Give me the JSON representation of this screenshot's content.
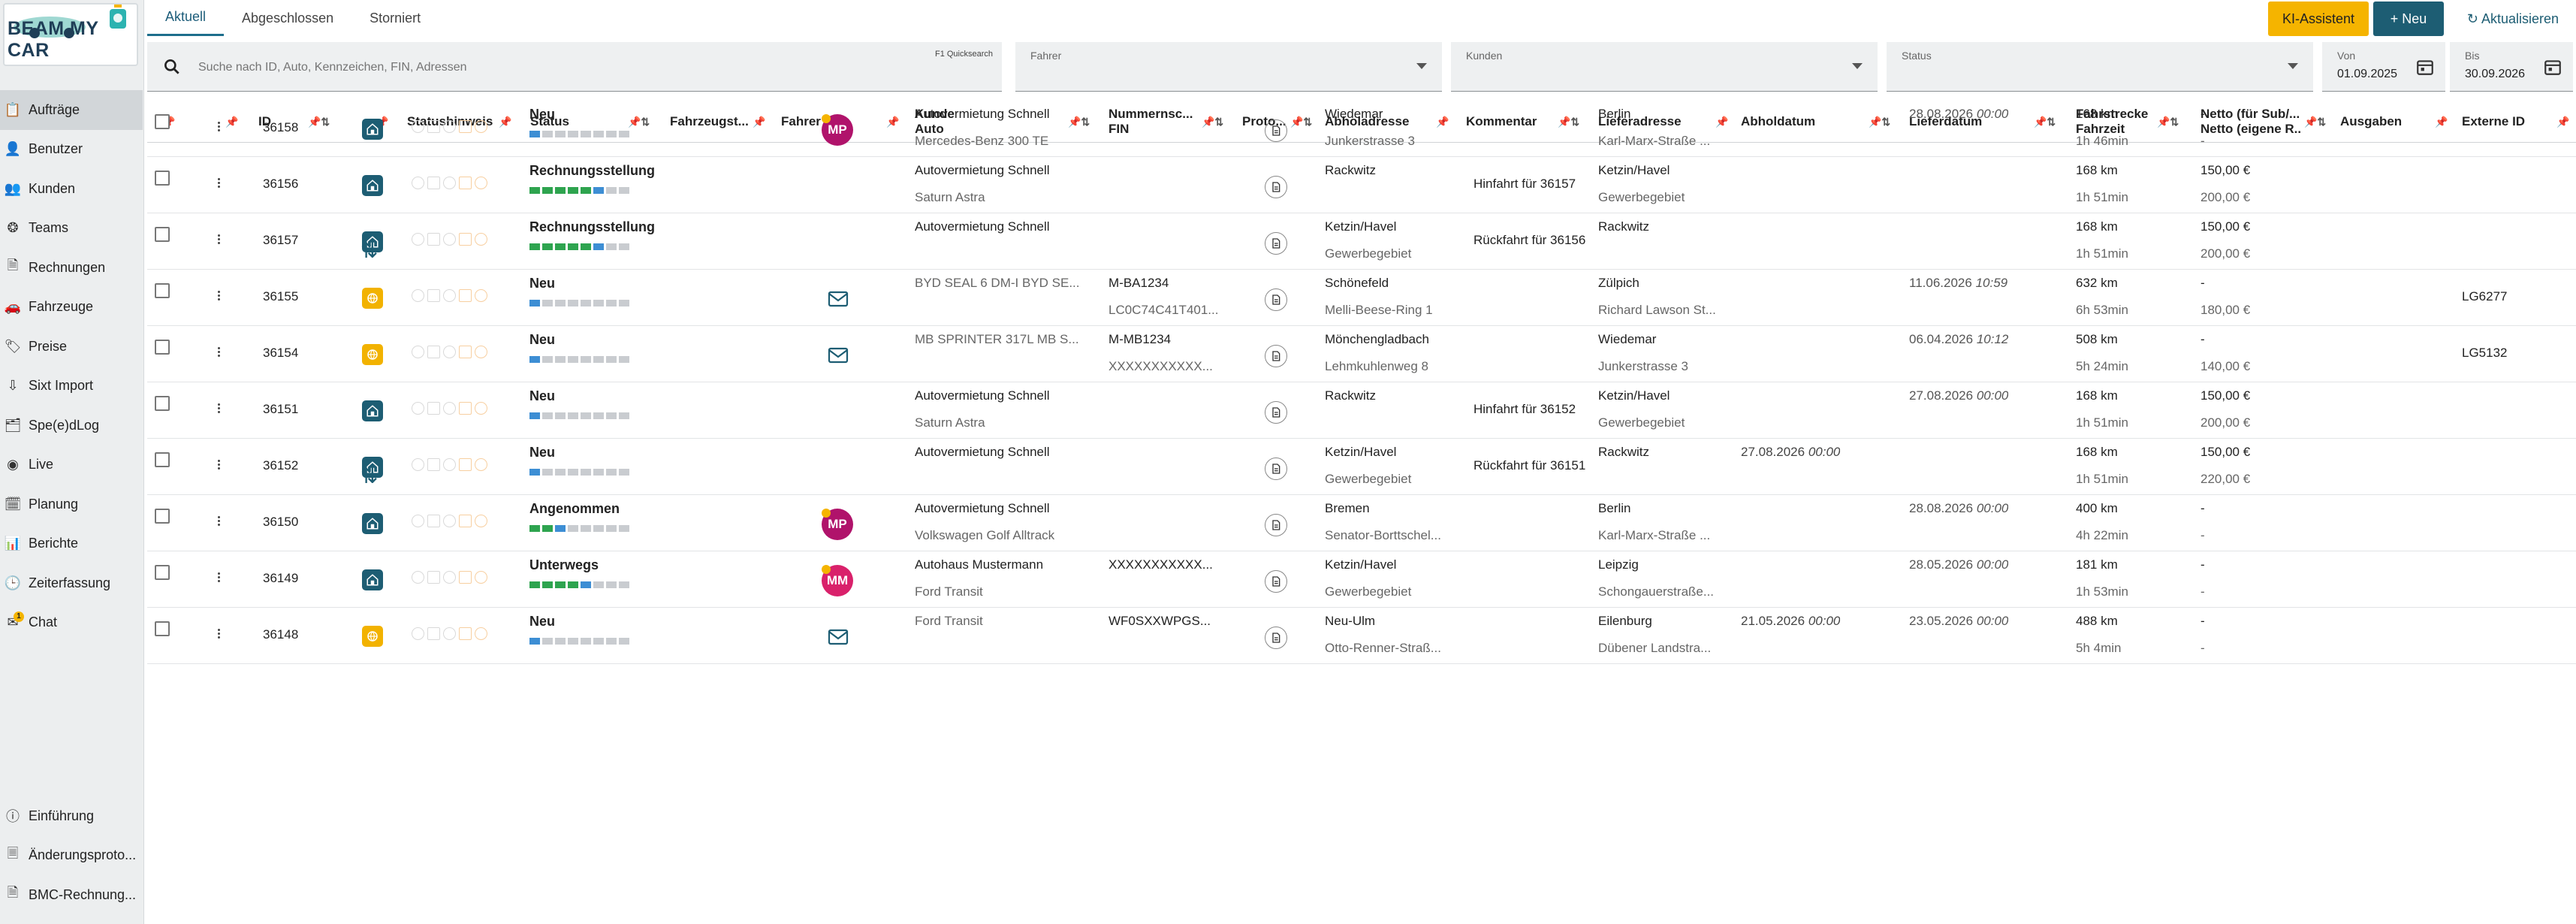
{
  "app": {
    "logo_text": "BEAM MY CAR"
  },
  "sidebar": {
    "items": [
      {
        "label": "Aufträge",
        "icon": "clipboard-icon",
        "active": true
      },
      {
        "label": "Benutzer",
        "icon": "user-icon"
      },
      {
        "label": "Kunden",
        "icon": "users-icon"
      },
      {
        "label": "Teams",
        "icon": "team-icon"
      },
      {
        "label": "Rechnungen",
        "icon": "invoice-icon"
      },
      {
        "label": "Fahrzeuge",
        "icon": "car-icon"
      },
      {
        "label": "Preise",
        "icon": "price-icon"
      },
      {
        "label": "Sixt Import",
        "icon": "import-icon"
      },
      {
        "label": "Spe(e)dLog",
        "icon": "log-icon"
      },
      {
        "label": "Live",
        "icon": "live-icon"
      },
      {
        "label": "Planung",
        "icon": "calendar-icon"
      },
      {
        "label": "Berichte",
        "icon": "chart-icon"
      },
      {
        "label": "Zeiterfassung",
        "icon": "clock-icon"
      },
      {
        "label": "Chat",
        "icon": "mail-icon",
        "badge": "1"
      }
    ],
    "bottom": [
      {
        "label": "Einführung",
        "icon": "info-icon"
      },
      {
        "label": "Änderungsproto...",
        "icon": "history-icon"
      },
      {
        "label": "BMC-Rechnung...",
        "icon": "invoice-icon"
      }
    ]
  },
  "tabs": [
    "Aktuell",
    "Abgeschlossen",
    "Storniert"
  ],
  "toolbar": {
    "ki": "KI-Assistent",
    "neu": "+ Neu",
    "refresh": "Aktualisieren"
  },
  "filters": {
    "search_placeholder": "Suche nach ID, Auto, Kennzeichen, FIN, Adressen",
    "quicksearch": "F1 Quicksearch",
    "fahrer": "Fahrer",
    "kunden": "Kunden",
    "status": "Status",
    "von_label": "Von",
    "von_value": "01.09.2025",
    "bis_label": "Bis",
    "bis_value": "30.09.2026"
  },
  "columns": {
    "id": "ID",
    "statushinweis": "Statushinweis",
    "status": "Status",
    "fahrzeug": "Fahrzeugst...",
    "fahrer": "Fahrer",
    "kunde": "Kunde",
    "auto": "Auto",
    "nummer": "Nummernsc...",
    "fin": "FIN",
    "proto": "Proto...",
    "abholadresse": "Abholadresse",
    "kommentar": "Kommentar",
    "lieferadresse": "Lieferadresse",
    "abholdatum": "Abholdatum",
    "lieferdatum": "Lieferdatum",
    "fahrstrecke": "Fahrstrecke",
    "fahrzeit": "Fahrzeit",
    "netto1": "Netto (für Sub/...",
    "netto2": "Netto (eigene R...",
    "ausgaben": "Ausgaben",
    "extern": "Externe ID"
  },
  "rows": [
    {
      "id": "36158",
      "tile": "teal",
      "status": "Neu",
      "prog": "b",
      "avatar": "MP",
      "avatar_color": "#b0136b",
      "kunde": "Autovermietung Schnell",
      "auto": "Mercedes-Benz 300 TE",
      "kunde_gray": false,
      "nr": "",
      "fin": "",
      "ab1": "Wiedemar",
      "ab2": "Junkerstrasse 3",
      "kom": "",
      "li1": "Berlin",
      "li2": "Karl-Marx-Straße ...",
      "abd": "",
      "abt": "",
      "lid": "28.08.2026",
      "lit": "00:00",
      "km": "168 km",
      "zeit": "1h 46min",
      "n1": "-",
      "n2": "-",
      "ext": ""
    },
    {
      "id": "36156",
      "tile": "teal",
      "status": "Rechnungsstellung",
      "prog": "g6",
      "avatar": "",
      "kunde": "Autovermietung Schnell",
      "auto": "Saturn Astra",
      "kunde_gray": false,
      "nr": "",
      "fin": "",
      "ab1": "Rackwitz",
      "ab2": "",
      "kom": "Hinfahrt für 36157",
      "li1": "Ketzin/Havel",
      "li2": "Gewerbegebiet",
      "abd": "",
      "abt": "",
      "lid": "",
      "lit": "",
      "km": "168 km",
      "zeit": "1h 51min",
      "n1": "150,00 €",
      "n2": "200,00 €",
      "ext": ""
    },
    {
      "id": "36157",
      "tile": "teal",
      "status": "Rechnungsstellung",
      "prog": "g6",
      "avatar": "",
      "kunde": "Autovermietung Schnell",
      "auto": "",
      "kunde_gray": false,
      "nr": "",
      "fin": "",
      "ab1": "Ketzin/Havel",
      "ab2": "Gewerbegebiet",
      "kom": "Rückfahrt für 36156",
      "li1": "Rackwitz",
      "li2": "",
      "abd": "",
      "abt": "",
      "lid": "",
      "lit": "",
      "km": "168 km",
      "zeit": "1h 51min",
      "n1": "150,00 €",
      "n2": "200,00 €",
      "ext": ""
    },
    {
      "id": "36155",
      "tile": "yellow",
      "status": "Neu",
      "prog": "b",
      "avatar": "mail",
      "kunde": "BYD SEAL 6 DM-I BYD SE...",
      "auto": "",
      "kunde_gray": true,
      "nr": "M-BA1234",
      "fin": "LC0C74C41T401...",
      "ab1": "Schönefeld",
      "ab2": "Melli-Beese-Ring 1",
      "kom": "",
      "li1": "Zülpich",
      "li2": "Richard Lawson St...",
      "abd": "",
      "abt": "",
      "lid": "11.06.2026",
      "lit": "10:59",
      "km": "632 km",
      "zeit": "6h 53min",
      "n1": "-",
      "n2": "180,00 €",
      "ext": "LG6277"
    },
    {
      "id": "36154",
      "tile": "yellow",
      "status": "Neu",
      "prog": "b",
      "avatar": "mail",
      "kunde": "MB SPRINTER 317L MB S...",
      "auto": "",
      "kunde_gray": true,
      "nr": "M-MB1234",
      "fin": "XXXXXXXXXXX...",
      "ab1": "Mönchengladbach",
      "ab2": "Lehmkuhlenweg 8",
      "kom": "",
      "li1": "Wiedemar",
      "li2": "Junkerstrasse 3",
      "abd": "",
      "abt": "",
      "lid": "06.04.2026",
      "lit": "10:12",
      "km": "508 km",
      "zeit": "5h 24min",
      "n1": "-",
      "n2": "140,00 €",
      "ext": "LG5132"
    },
    {
      "id": "36151",
      "tile": "teal",
      "status": "Neu",
      "prog": "b",
      "avatar": "",
      "kunde": "Autovermietung Schnell",
      "auto": "Saturn Astra",
      "kunde_gray": false,
      "nr": "",
      "fin": "",
      "ab1": "Rackwitz",
      "ab2": "",
      "kom": "Hinfahrt für 36152",
      "li1": "Ketzin/Havel",
      "li2": "Gewerbegebiet",
      "abd": "",
      "abt": "",
      "lid": "27.08.2026",
      "lit": "00:00",
      "km": "168 km",
      "zeit": "1h 51min",
      "n1": "150,00 €",
      "n2": "200,00 €",
      "ext": ""
    },
    {
      "id": "36152",
      "tile": "teal",
      "status": "Neu",
      "prog": "b",
      "avatar": "",
      "kunde": "Autovermietung Schnell",
      "auto": "",
      "kunde_gray": false,
      "nr": "",
      "fin": "",
      "ab1": "Ketzin/Havel",
      "ab2": "Gewerbegebiet",
      "kom": "Rückfahrt für 36151",
      "li1": "Rackwitz",
      "li2": "",
      "abd": "27.08.2026",
      "abt": "00:00",
      "lid": "",
      "lit": "",
      "km": "168 km",
      "zeit": "1h 51min",
      "n1": "150,00 €",
      "n2": "220,00 €",
      "ext": ""
    },
    {
      "id": "36150",
      "tile": "teal",
      "status": "Angenommen",
      "prog": "g2",
      "avatar": "MP",
      "avatar_color": "#b0136b",
      "kunde": "Autovermietung Schnell",
      "auto": "Volkswagen Golf Alltrack",
      "kunde_gray": false,
      "nr": "",
      "fin": "",
      "ab1": "Bremen",
      "ab2": "Senator-Borttschel...",
      "kom": "",
      "li1": "Berlin",
      "li2": "Karl-Marx-Straße ...",
      "abd": "",
      "abt": "",
      "lid": "28.08.2026",
      "lit": "00:00",
      "km": "400 km",
      "zeit": "4h 22min",
      "n1": "-",
      "n2": "-",
      "ext": ""
    },
    {
      "id": "36149",
      "tile": "teal",
      "status": "Unterwegs",
      "prog": "g4",
      "avatar": "MM",
      "avatar_color": "#d9216b",
      "kunde": "Autohaus Mustermann",
      "auto": "Ford Transit",
      "kunde_gray": false,
      "nr": "XXXXXXXXXXX...",
      "fin": "",
      "ab1": "Ketzin/Havel",
      "ab2": "Gewerbegebiet",
      "kom": "",
      "li1": "Leipzig",
      "li2": "Schongauerstraße...",
      "abd": "",
      "abt": "",
      "lid": "28.05.2026",
      "lit": "00:00",
      "km": "181 km",
      "zeit": "1h 53min",
      "n1": "-",
      "n2": "-",
      "ext": ""
    },
    {
      "id": "36148",
      "tile": "yellow",
      "status": "Neu",
      "prog": "b",
      "avatar": "mail",
      "kunde": "Ford Transit",
      "auto": "",
      "kunde_gray": true,
      "nr": "WF0SXXWPGS...",
      "fin": "",
      "ab1": "Neu-Ulm",
      "ab2": "Otto-Renner-Straß...",
      "kom": "",
      "li1": "Eilenburg",
      "li2": "Dübener Landstra...",
      "abd": "21.05.2026",
      "abt": "00:00",
      "lid": "23.05.2026",
      "lit": "00:00",
      "km": "488 km",
      "zeit": "5h 4min",
      "n1": "-",
      "n2": "-",
      "ext": ""
    }
  ],
  "colors": {
    "teal": "#1d5d73",
    "yellow": "#f2b200",
    "accent": "#f5b400"
  }
}
